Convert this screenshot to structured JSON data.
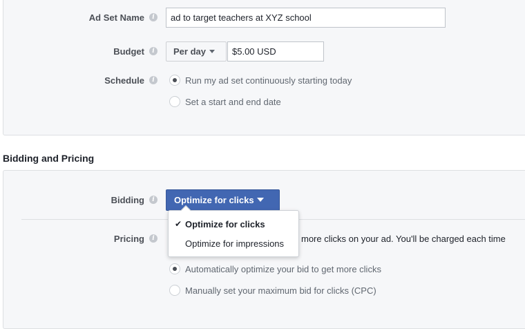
{
  "ad_set": {
    "name_label": "Ad Set Name",
    "name_value": "ad to target teachers at XYZ school",
    "budget_label": "Budget",
    "budget_period": "Per day",
    "budget_amount": "$5.00 USD",
    "schedule_label": "Schedule",
    "schedule_options": [
      {
        "label": "Run my ad set continuously starting today",
        "checked": true
      },
      {
        "label": "Set a start and end date",
        "checked": false
      }
    ]
  },
  "bidding_section": {
    "title": "Bidding and Pricing",
    "bidding_label": "Bidding",
    "bidding_button": "Optimize for clicks",
    "dropdown_items": [
      {
        "label": "Optimize for clicks",
        "selected": true
      },
      {
        "label": "Optimize for impressions",
        "selected": false
      }
    ],
    "pricing_label": "Pricing",
    "pricing_text_visible": "more clicks on your ad. You'll be charged each time",
    "pricing_options": [
      {
        "label": "Automatically optimize your bid to get more clicks",
        "checked": true
      },
      {
        "label": "Manually set your maximum bid for clicks (CPC)",
        "checked": false
      }
    ]
  },
  "icons": {
    "info": "info-icon",
    "checkmark": "check-icon",
    "caret": "caret-down-icon"
  },
  "colors": {
    "primary": "#4267b2",
    "panel_bg": "#f6f7f9",
    "border": "#dddfe2"
  }
}
